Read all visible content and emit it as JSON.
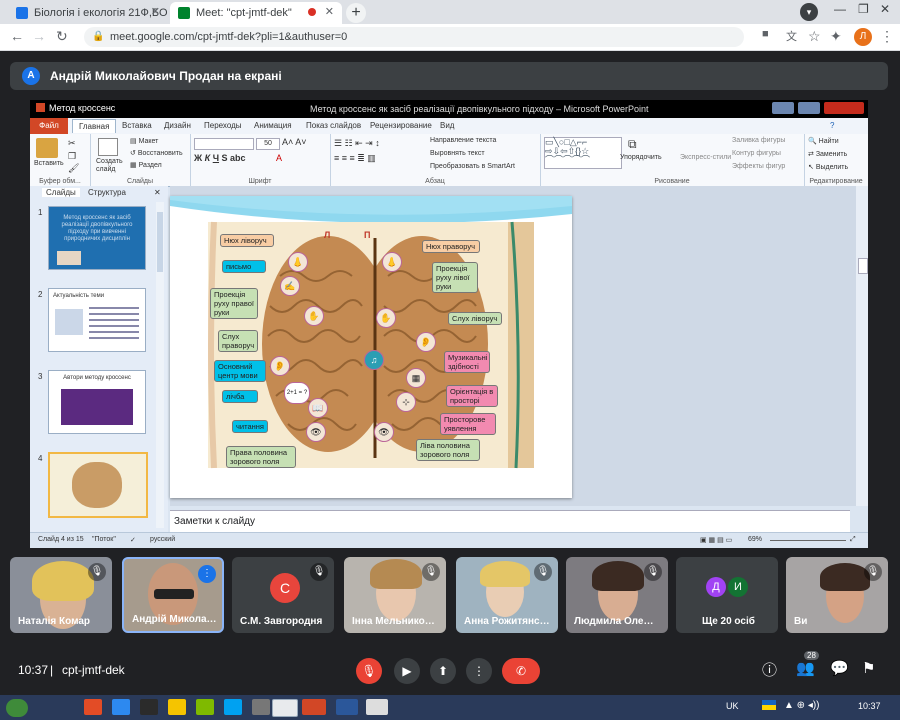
{
  "browser": {
    "tabs": [
      {
        "title": "Біологія і екологія 21Ф,БО",
        "active": false
      },
      {
        "title": "Meet: \"cpt-jmtf-dek\"",
        "active": true
      }
    ],
    "new_tab": "+",
    "url": "meet.google.com/cpt-jmtf-dek?pli=1&authuser=0",
    "profile_initial": "Л"
  },
  "meet": {
    "presenter_initial": "А",
    "presenter_text": "Андрій Миколайович Продан на екрані",
    "meeting_time": "10:37",
    "meeting_code": "cpt-jmtf-dek",
    "participants_count": "28",
    "tiles": [
      {
        "name": "Наталія Комар"
      },
      {
        "name": "Андрій Микола…"
      },
      {
        "name": "С.М. Завгородня",
        "initial": "С"
      },
      {
        "name": "Інна Мельнико…"
      },
      {
        "name": "Анна Рожитянс…"
      },
      {
        "name": "Людмила Оле…"
      },
      {
        "name": "Ще 20 осіб",
        "initials": [
          "Д",
          "И"
        ]
      },
      {
        "name": "Ви"
      }
    ]
  },
  "ppt": {
    "app": "Метод кроссенс",
    "window_title": "Метод кроссенс як засіб реалізації двопівкульного підходу  –  Microsoft PowerPoint",
    "tabs": [
      "Файл",
      "Главная",
      "Вставка",
      "Дизайн",
      "Переходы",
      "Анимация",
      "Показ слайдов",
      "Рецензирование",
      "Вид"
    ],
    "ribbon": {
      "paste": "Вставить",
      "clipboard": "Буфер обм...",
      "new_slide": "Создать слайд",
      "layout": "Макет",
      "reset": "Восстановить",
      "section": "Раздел",
      "slides_group": "Слайды",
      "font_group": "Шрифт",
      "paragraph_group": "Абзац",
      "text_direction": "Направление текста",
      "align_text": "Выровнять текст",
      "smartart": "Преобразовать в SmartArt",
      "drawing_group": "Рисование",
      "arrange": "Упорядочить",
      "quick_styles": "Экспресс-стили",
      "fill": "Заливка фигуры",
      "outline": "Контур фигуры",
      "effects": "Эффекты фигур",
      "find": "Найти",
      "replace": "Заменить",
      "select": "Выделить",
      "editing_group": "Редактирование",
      "font_size": "50"
    },
    "left_tabs": [
      "Слайды",
      "Структура"
    ],
    "thumbs": [
      {
        "num": "1",
        "text": "Метод кроссенс як засіб реалізації двопівкульного підходу при вивченні природничих дисциплін"
      },
      {
        "num": "2",
        "text": "Актуальність теми"
      },
      {
        "num": "3",
        "text": "Автори методу кроссенс"
      },
      {
        "num": "4",
        "text": ""
      }
    ],
    "notes": "Заметки к слайду",
    "status": {
      "slide": "Слайд 4 из 15",
      "theme": "\"Поток\"",
      "lang": "русский",
      "zoom": "69%"
    },
    "slide": {
      "left_marker": "Л",
      "right_marker": "П",
      "labels": {
        "smell_left": "Нюх ліворуч",
        "writing": "письмо",
        "right_hand_proj": "Проекція руху правої руки",
        "hearing_right": "Слух праворуч",
        "speech_center": "Основний центр мови",
        "counting": "лічба",
        "reading": "читання",
        "right_visual": "Права половина зорового поля",
        "smell_right": "Нюх праворуч",
        "left_hand_proj": "Проекція руху лівої руки",
        "hearing_left": "Слух ліворуч",
        "music": "Музикальні здібності",
        "orientation": "Орієнтація в просторі",
        "spatial": "Просторове уявлення",
        "left_visual": "Ліва половина зорового поля",
        "math": "2+1 = ?"
      }
    }
  },
  "taskbar": {
    "lang": "UK",
    "time": "10:37"
  }
}
